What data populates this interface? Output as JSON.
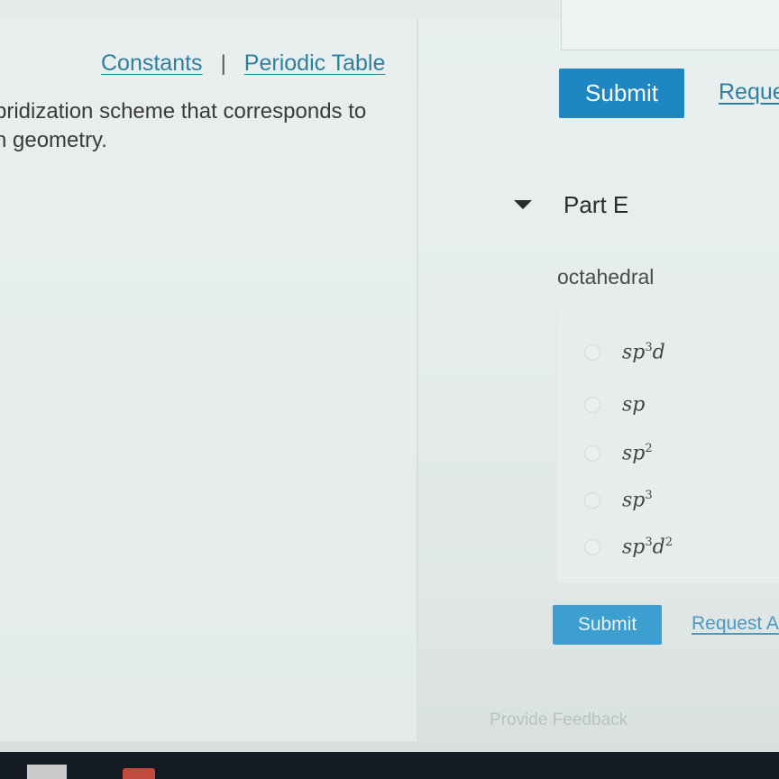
{
  "left_panel": {
    "links": {
      "constants": "Constants",
      "separator": "|",
      "periodic_table": "Periodic Table"
    },
    "intro_line1": "pridization scheme that corresponds to",
    "intro_line2": "n geometry."
  },
  "previous_part": {
    "submit_label": "Submit",
    "request_label": "Reque"
  },
  "part_e": {
    "title": "Part E",
    "geometry": "octahedral",
    "options": [
      {
        "base": "sp",
        "sup1": "3",
        "rest": "d",
        "sup2": ""
      },
      {
        "base": "sp",
        "sup1": "",
        "rest": "",
        "sup2": ""
      },
      {
        "base": "sp",
        "sup1": "2",
        "rest": "",
        "sup2": ""
      },
      {
        "base": "sp",
        "sup1": "3",
        "rest": "",
        "sup2": ""
      },
      {
        "base": "sp",
        "sup1": "3",
        "rest": "d",
        "sup2": "2"
      }
    ],
    "submit_label": "Submit",
    "request_label": "Request A"
  },
  "footer": {
    "feedback_label": "Provide Feedback"
  }
}
